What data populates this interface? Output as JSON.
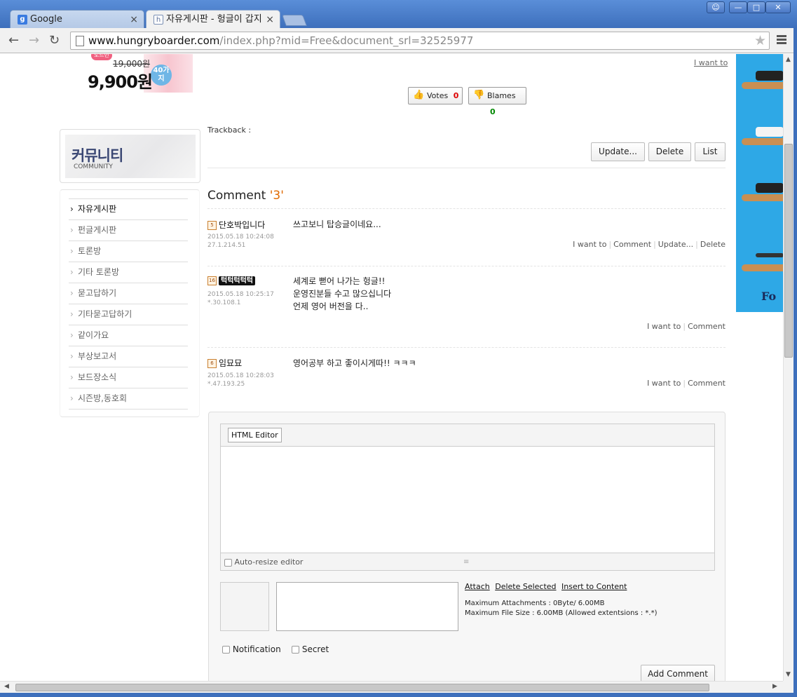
{
  "browser": {
    "tabs": [
      {
        "title": "Google",
        "favicon": "g"
      },
      {
        "title": "자유게시판 - 헝글이 갑지",
        "favicon": "h"
      }
    ],
    "url_domain": "www.hungryboarder.com",
    "url_path": "/index.php?mid=Free&document_srl=32525977"
  },
  "promo": {
    "bubble": "도트만",
    "old_price": "19,000원",
    "new_price": "9,900원",
    "badge": "40가지"
  },
  "post": {
    "i_want_to": "I want to",
    "votes_label": "Votes",
    "votes_count": "0",
    "blames_label": "Blames",
    "blames_count": "0",
    "trackback": "Trackback :",
    "update_label": "Update...",
    "delete_label": "Delete",
    "list_label": "List"
  },
  "sidebar": {
    "title_ko": "커뮤니티",
    "title_en": "COMMUNITY",
    "items": [
      {
        "label": "자유게시판"
      },
      {
        "label": "펀글게시판"
      },
      {
        "label": "토론방"
      },
      {
        "label": "기타 토론방"
      },
      {
        "label": "묻고답하기"
      },
      {
        "label": "기타묻고답하기"
      },
      {
        "label": "같이가요"
      },
      {
        "label": "부상보고서"
      },
      {
        "label": "보드장소식"
      },
      {
        "label": "시즌방,동호회"
      }
    ]
  },
  "comments": {
    "heading": "Comment",
    "count": "'3'",
    "items": [
      {
        "level": "5",
        "author": "단호박입니다",
        "date": "2015.05.18 10:24:08",
        "ip": "27.1.214.51",
        "lines": [
          "쓰고보니 탑승글이네요..."
        ],
        "actions": [
          "I want to",
          "Comment",
          "Update...",
          "Delete"
        ]
      },
      {
        "level": "16",
        "author": "턱턱턱턱턱",
        "date": "2015.05.18 10:25:17",
        "ip": "*.30.108.1",
        "lines": [
          "세계로 뻗어 나가는 헝글!!",
          "운영진분들 수고 많으십니다",
          "언제 영어 버전을 다.."
        ],
        "actions": [
          "I want to",
          "Comment"
        ]
      },
      {
        "level": "6",
        "author": "임묘묘",
        "date": "2015.05.18 10:28:03",
        "ip": "*.47.193.25",
        "lines": [
          "영어공부 하고 좋이시게따!! ㅋㅋㅋ"
        ],
        "actions": [
          "I want to",
          "Comment"
        ]
      }
    ]
  },
  "editor": {
    "html_editor_label": "HTML Editor",
    "auto_resize_label": "Auto-resize editor",
    "attach_label": "Attach",
    "delete_selected_label": "Delete Selected",
    "insert_label": "Insert to Content",
    "max_attach": "Maximum Attachments : 0Byte/ 6.00MB",
    "max_file": "Maximum File Size : 6.00MB (Allowed extentsions : *.*)",
    "notification_label": "Notification",
    "secret_label": "Secret",
    "submit_label": "Add Comment"
  },
  "ad": {
    "text": "Fo"
  },
  "colors": {
    "accent": "#e06a00",
    "titlebar": "#3d6fbc",
    "ad_bg": "#2ea8e6"
  }
}
